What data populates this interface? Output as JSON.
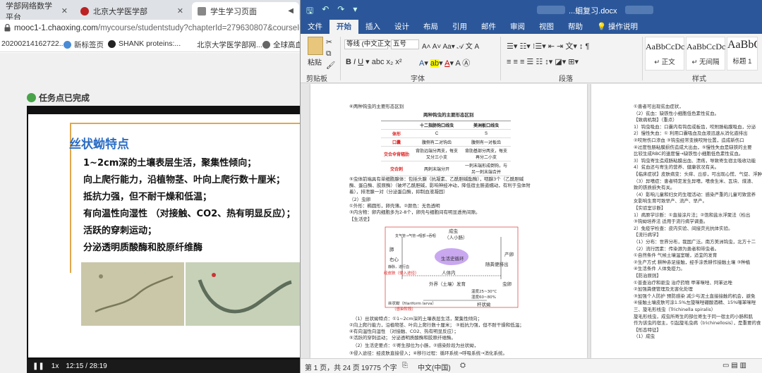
{
  "browser": {
    "tabs": [
      {
        "label": "学部网络数学平台"
      },
      {
        "label": "北京大学医学部"
      },
      {
        "label": "学生学习页面"
      }
    ],
    "url_main": "mooc1-1.chaoxing.com",
    "url_rest": "/mycourse/studentstudy?chapterId=279630807&courseId=2",
    "bookmarks": [
      "20200214162722...",
      "新标签页",
      "SHANK proteins:...",
      "北京大学医学部网...",
      "全球高血"
    ],
    "task_status": "任务点已完成",
    "slide": {
      "title": "丝状蚴特点",
      "lines": [
        "1~2cm深的土壤表层生活，聚集性倾向；",
        "向上爬行能力，沿植物茎、叶向上爬行数十厘米；",
        "抵抗力强，但不耐干燥和低温；",
        "有向温性向湿性  （对接触、CO2、热有明显反应）；",
        "活跃的穿刺运动；",
        "分泌透明质酸酶和胶原纤维酶"
      ]
    },
    "player": {
      "speed": "1x",
      "time": "12:15 / 28:19"
    }
  },
  "word": {
    "qat_icons": [
      "save-icon",
      "undo-icon",
      "redo-icon",
      "customize-icon"
    ],
    "title": "...蛔复习.docx",
    "menus": [
      "文件",
      "开始",
      "插入",
      "设计",
      "布局",
      "引用",
      "邮件",
      "审阅",
      "视图",
      "帮助",
      "操作说明"
    ],
    "ribbon": {
      "paste_label": "粘贴",
      "clipboard_label": "剪贴板",
      "font_label": "字体",
      "paragraph_label": "段落",
      "styles_label": "样式",
      "font_name": "等线 (中文正文",
      "font_size": "五号",
      "styles": [
        {
          "sample": "AaBbCcDc",
          "name": "正文"
        },
        {
          "sample": "AaBbCcDc",
          "name": "无间隔"
        },
        {
          "sample": "AaBbC",
          "name": "标题 1"
        },
        {
          "sample": "Aa",
          "name": ""
        }
      ]
    },
    "doc_left": {
      "heading": "⑥两种钩虫的主要形态区别",
      "table_title": "两种钩虫的主要形态区别",
      "table_headers": [
        "",
        "十二指肠钩口线虫",
        "美洲板口线虫"
      ],
      "table_rows": [
        [
          "体形",
          "C",
          "S"
        ],
        [
          "口囊",
          "腹侧有二对钩齿",
          "腹侧有一对板齿"
        ],
        [
          "交合伞背辐肋",
          "背肋远端分两支，每支又分三小支",
          "背肋基部分两支，每支再分二小支"
        ],
        [
          "交合刺",
          "两刺末端分开",
          "一刺末端形成倒钩，与另一刺末端合并"
        ]
      ],
      "lines": [
        "⑤虫体前端具有单细胞腺体：包括头腺（抗凝素、乙酰胆碱酯酶），咽腺3个（乙酰胆碱",
        "酶、蛋白酶、胶原酶）（破坏乙酰胆碱，影响神经冲动，降低宿主肠道蠕动，有利于虫体附",
        "着），排泄腺一对（分泌蛋白酶，抑制血液凝固）",
        "（2）虫卵",
        "①外形：椭圆形，卵壳薄。②颜色：无色透明",
        "③内含物：卵内细胞多为2-8个，卵壳与细胞间有明显透亮间隙。",
        "【生活史】",
        "（1）丝状蚴特点：①1~2cm深的土壤表层生活，聚集性倾向；",
        "②向上爬行能力，沿植物茎、叶向上爬行数十厘米；  ③抵抗力强，但不耐干燥和低温；",
        "④有向温性向湿性  （对接触、CO2、热有明显反应）；",
        "⑤活跃的穿刺运动；  分泌透明质酸酶和胶原纤维酶。",
        "（2）生活史要点：①寄生部位为小肠，②感染阶段为丝状蚴，",
        "③侵入途径：经皮肤直接侵入；④移行过程：循环系统→呼吸系统→消化系统。"
      ],
      "diagram": {
        "center": "生活史循环",
        "top": "成虫",
        "top_sub": "（人小肠）",
        "top_left": "支气管→气管→咽部→吞咽",
        "left": "肺",
        "right": "产卵",
        "right_sub": "随粪便排出",
        "host": "人体内",
        "outside": "外界（土壤）发育",
        "temp": "温度25~30°C",
        "humidity": "湿度60~80%",
        "egg": "虫卵",
        "larva": "杆状蚴",
        "filariform": "丝状蚴（filariform larva）",
        "infective": "（感染阶段）",
        "skin": "经皮肤（侵入途径）",
        "vessel": "静脉，进行血",
        "heart": "右心"
      }
    },
    "doc_right": {
      "lines": [
        "①患者可出现贫血症状，",
        "（2）贫血：缺铁性小细胞低色素性贫血。",
        "【致病机制】（重点）",
        "1）钩虫吸血：口囊内有钩齿或板齿，咬附肠粘膜吸血，分泌",
        "2）慢性失血：①  利用口囊吸血及血液迅速从消化道排出",
        "②咬附伤口渗血  ③钩虫经常变换咬附位置，造成新伤口",
        "④过度性肠粘膜损伤造成大出血，⑤慢性失血是缺铁的主要",
        "比较生成RBC的速度慢→缺铁性小细胞低色素性贫血。",
        "3）钩虫寄生造成肠粘膜出血、溃疡，导致寄生宿主吸收功能",
        "4）贫血还与寄生的营养、健康状况有关。",
        "【临床症状】皮肤病变：头痒、丘疹，可出现心慌、气促、浮肿",
        "（3）异嗜症：患者特定发生异嗜，嗜食生米、瓦块、煤渣、",
        "致的铁质损失有关。",
        "（4）影响儿童和妇女的生理活动：感染严重的儿童可致营养",
        "女影响生育可致早产、流产、早产。",
        "【实验室诊断】",
        "1）病原学诊断：①直接涂片法；②饱和盐水浮聚法（检出",
        "③钩蚴培养法  适用于流行病学调查。",
        "2）免疫学检查：皮内实验、间接荧光抗体实验。",
        "【流行病学】",
        "（1）分布：世界分布，我国广泛。南方美洲钩虫，北方十二",
        "（2）流行因素：传染源为患者和带虫者。",
        "①自然条件  气候土壤温室暖，适宜的发育",
        "②生产方式  耕种赤足接触，经手涂丢耕作接触土壤  ③种植",
        "④生活条件  人体免疫力。",
        "【防治原则】",
        "①普查治疗和驱虫  治疗药物  甲苯咪唑、阿苯达唑",
        "②加强粪便管理及无害化处理",
        "③加强个人防护  预防感染  减少与泥土直接接触的机会，避免",
        "④接触土壤皮肤可涂1.5%左旋咪唑硼酸酒精、15%噻苯咪唑",
        "三、旋毛形线虫（Trichinella spiralis）",
        "旋毛形线虫，成虫所寄生的部位寄生于同一宿主的小肠和肌",
        "作为该虫的宿主，引起旋毛虫病（trichinellosis），是重要的食",
        "【形态特征】",
        "（1）成虫"
      ]
    },
    "status": {
      "page": "第 1 页，共 24 页",
      "words": "19775 个字",
      "lang": "中文(中国)"
    }
  }
}
